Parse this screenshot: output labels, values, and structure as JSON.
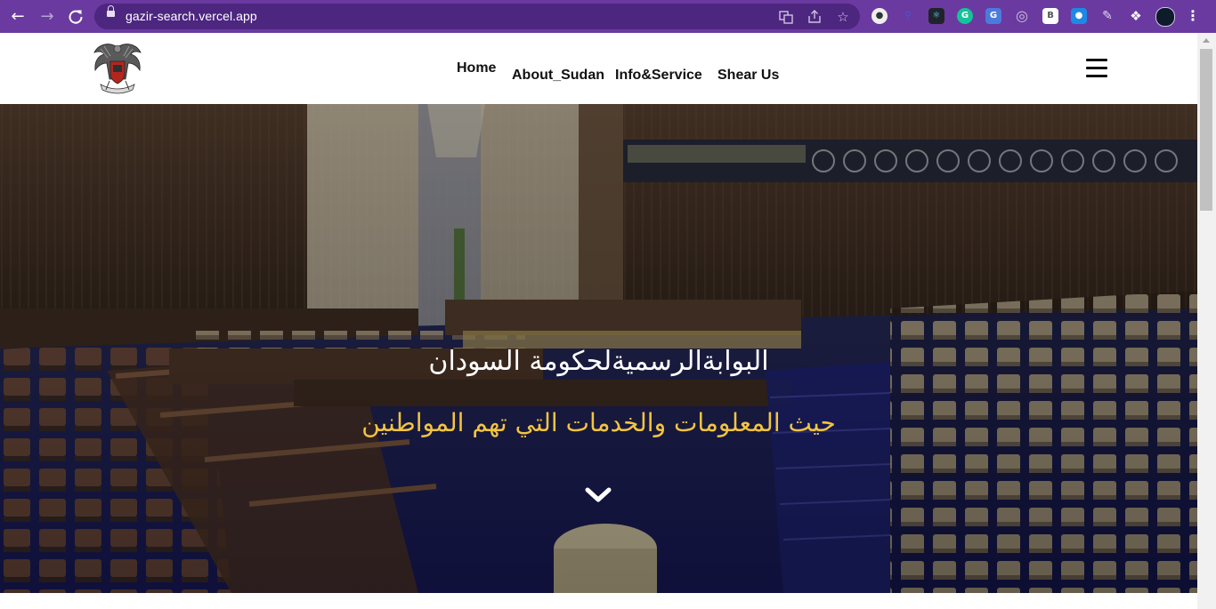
{
  "browser": {
    "url": "gazir-search.vercel.app",
    "accent": "#6a3aa0",
    "nav_icons": [
      "back-icon",
      "forward-icon",
      "reload-icon"
    ],
    "omnibox_icons": [
      "translate-icon",
      "share-icon",
      "bookmark-star-icon"
    ],
    "extension_icons": [
      "extension-a-icon",
      "extension-search-icon",
      "react-devtools-icon",
      "grammarly-icon",
      "translate-ext-icon",
      "extension-circle-icon",
      "extension-b-icon",
      "extension-drop-icon",
      "extension-pen-icon",
      "extensions-puzzle-icon",
      "profile-avatar-icon",
      "chrome-menu-icon"
    ]
  },
  "site": {
    "nav": {
      "home": "Home",
      "about": "About_Sudan",
      "info": "Info&Service",
      "share": "Shear Us"
    },
    "hero": {
      "title": "البوابةالرسميةلحكومة السودان",
      "subtitle": "حيث المعلومات والخدمات التي تهم المواطنين",
      "subtitle_color": "#f3c441"
    }
  }
}
